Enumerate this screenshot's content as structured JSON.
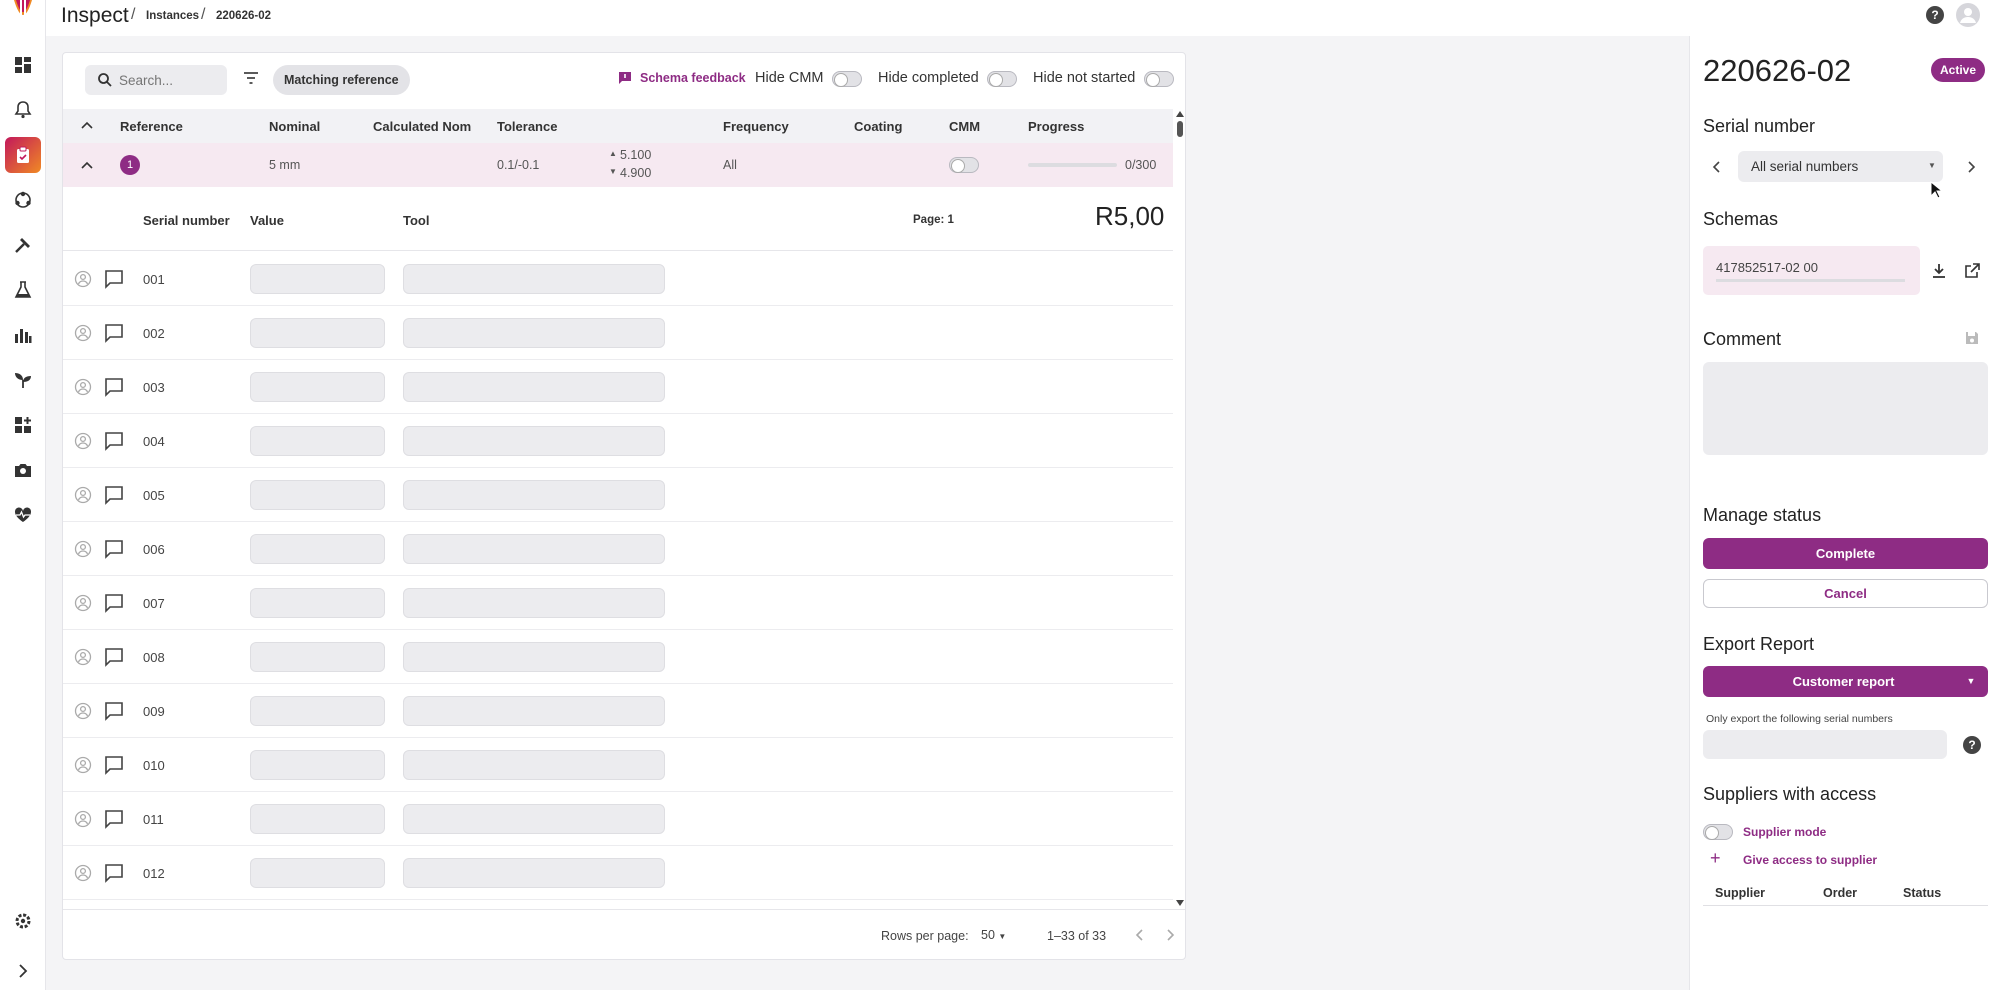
{
  "app": {
    "title": "Inspect"
  },
  "breadcrumb": {
    "items": [
      "Instances",
      "220626-02"
    ]
  },
  "toolbar": {
    "search_placeholder": "Search...",
    "matching_reference": "Matching reference",
    "schema_feedback": "Schema feedback",
    "hide_cmm": "Hide CMM",
    "hide_completed": "Hide completed",
    "hide_not_started": "Hide not started"
  },
  "table": {
    "columns": [
      "Reference",
      "Nominal",
      "Calculated Nom",
      "Tolerance",
      "Frequency",
      "Coating",
      "CMM",
      "Progress"
    ],
    "reference_row": {
      "index": "1",
      "nominal": "5 mm",
      "tolerance": "0.1/-0.1",
      "upper": "5.100",
      "lower": "4.900",
      "frequency": "All",
      "progress_text": "0/300",
      "progress": 0
    },
    "sub_columns": [
      "Serial number",
      "Value",
      "Tool"
    ],
    "page_label": "Page: 1",
    "reference_code": "R5,00",
    "serials": [
      "001",
      "002",
      "003",
      "004",
      "005",
      "006",
      "007",
      "008",
      "009",
      "010",
      "011",
      "012"
    ]
  },
  "pagination": {
    "rows_per_page_label": "Rows per page:",
    "rows_per_page": "50",
    "range": "1–33 of 33"
  },
  "panel": {
    "instance_id": "220626-02",
    "status": "Active",
    "serial_number_title": "Serial number",
    "serial_select": "All serial numbers",
    "schemas_title": "Schemas",
    "schema_file": "417852517-02 00",
    "comment_title": "Comment",
    "manage_status_title": "Manage status",
    "complete": "Complete",
    "cancel": "Cancel",
    "export_title": "Export Report",
    "customer_report": "Customer report",
    "export_hint": "Only export the following serial numbers",
    "suppliers_title": "Suppliers with access",
    "supplier_mode": "Supplier mode",
    "give_access": "Give access to supplier",
    "supplier_columns": [
      "Supplier",
      "Order",
      "Status"
    ]
  },
  "colors": {
    "accent": "#8e2c84",
    "highlight_row": "#f6e9f1"
  },
  "icons": [
    "dashboard-icon",
    "bell-icon",
    "clipboard-icon",
    "network-icon",
    "tools-icon",
    "flask-icon",
    "chart-icon",
    "sprout-icon",
    "add-widget-icon",
    "camera-icon",
    "heart-pulse-icon",
    "settings-icon",
    "expand-icon"
  ]
}
